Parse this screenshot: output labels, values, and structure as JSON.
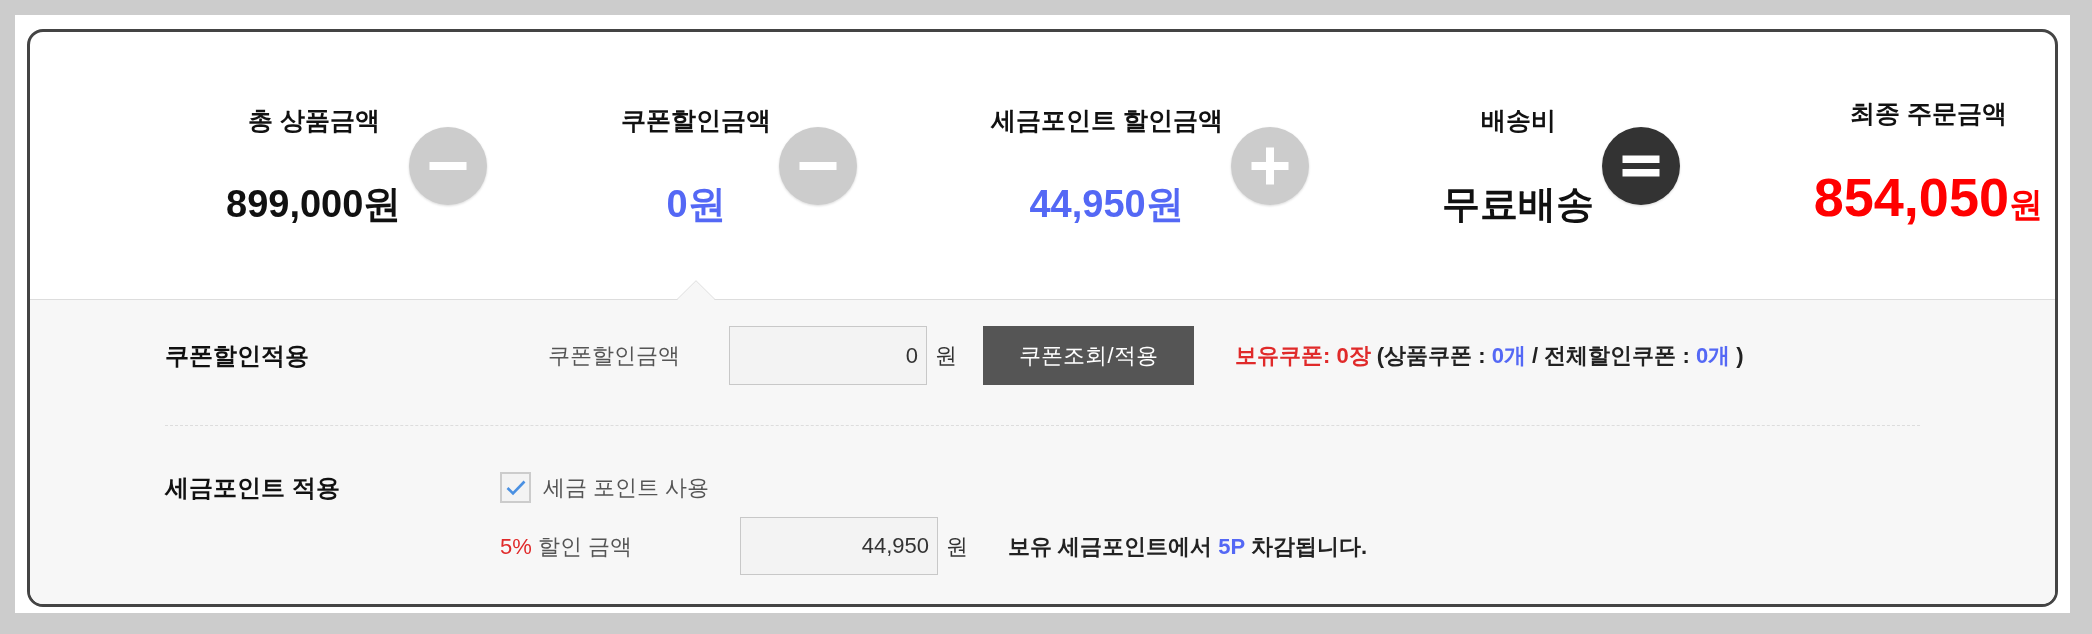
{
  "summary": {
    "items": [
      {
        "label": "총 상품금액",
        "value": "899,000",
        "unit": "원",
        "kind": "amount",
        "selected": false
      },
      {
        "label": "쿠폰할인금액",
        "value": "0",
        "unit": "원",
        "kind": "discount",
        "selected": true
      },
      {
        "label": "세금포인트 할인금액",
        "value": "44,950",
        "unit": "원",
        "kind": "discount",
        "selected": false
      },
      {
        "label": "배송비",
        "value": "무료배송",
        "kind": "amount",
        "selected": false
      },
      {
        "label": "최종 주문금액",
        "value": "854,050",
        "unit": "원",
        "kind": "final",
        "selected": false
      }
    ],
    "operators": [
      {
        "kind": "minus"
      },
      {
        "kind": "minus"
      },
      {
        "kind": "plus"
      },
      {
        "kind": "equals"
      }
    ]
  },
  "coupon": {
    "title": "쿠폰할인적용",
    "field_label": "쿠폰할인금액",
    "value": "0",
    "unit": "원",
    "button": "쿠폰조회/적용",
    "info": [
      {
        "text": "보유쿠폰: 0장",
        "kind": "alert"
      },
      {
        "text": "(상품쿠폰 :",
        "kind": "plain"
      },
      {
        "text": "0개",
        "kind": "count"
      },
      {
        "text": "/ 전체할인쿠폰 :",
        "kind": "plain"
      },
      {
        "text": "0개",
        "kind": "count"
      },
      {
        "text": ")",
        "kind": "plain"
      }
    ]
  },
  "points": {
    "title": "세금포인트 적용",
    "checkbox": {
      "label": "세금 포인트 사용",
      "checked": true
    },
    "amount_label": [
      {
        "text": "5%",
        "kind": "alert"
      },
      {
        "text": "할인 금액",
        "kind": "plain"
      }
    ],
    "value": "44,950",
    "unit": "원",
    "message": [
      {
        "text": "보유 세금포인트에서",
        "kind": "plain"
      },
      {
        "text": "5P",
        "kind": "count"
      },
      {
        "text": "차감됩니다.",
        "kind": "plain"
      }
    ]
  }
}
